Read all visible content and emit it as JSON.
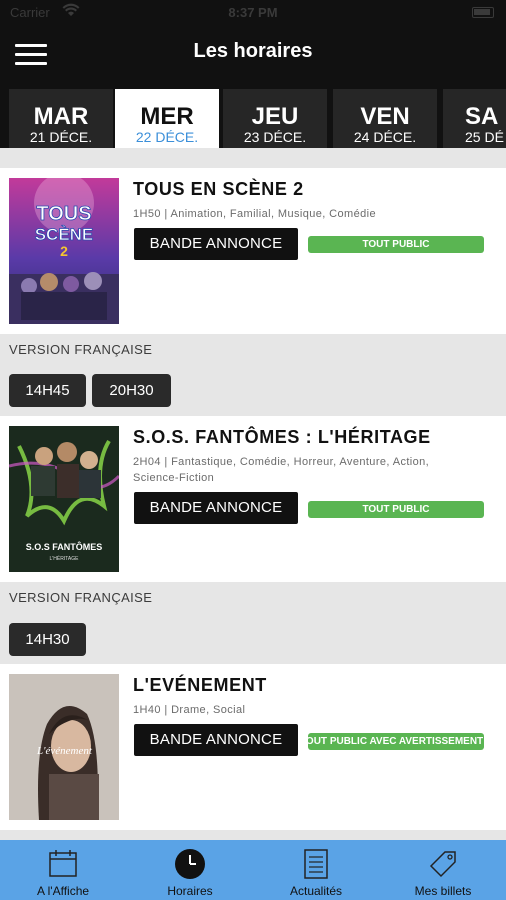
{
  "status": {
    "carrier": "Carrier",
    "time": "8:37 PM"
  },
  "header": {
    "title": "Les horaires"
  },
  "days": [
    {
      "day": "MAR",
      "date": "21 DÉCE."
    },
    {
      "day": "MER",
      "date": "22 DÉCE."
    },
    {
      "day": "JEU",
      "date": "23 DÉCE."
    },
    {
      "day": "VEN",
      "date": "24 DÉCE."
    },
    {
      "day": "SA",
      "date": "25 DÉ"
    }
  ],
  "movies": [
    {
      "title": "TOUS EN SCÈNE 2",
      "meta": "1H50 | Animation, Familial, Musique, Comédie",
      "trailer": "BANDE ANNONCE",
      "rating": "TOUT PUBLIC",
      "poster_text_1": "TOUS",
      "poster_text_2": "SCÈNE",
      "poster_text_3": "2",
      "version": "VERSION FRANÇAISE",
      "showtimes": [
        "14H45",
        "20H30"
      ]
    },
    {
      "title": "S.O.S. FANTÔMES : L'HÉRITAGE",
      "meta_1": "2H04 | Fantastique, Comédie, Horreur, Aventure, Action,",
      "meta_2": "Science-Fiction",
      "trailer": "BANDE ANNONCE",
      "rating": "TOUT PUBLIC",
      "poster_text_1": "S.O.S FANTÔMES",
      "poster_text_2": "L'HÉRITAGE",
      "version": "VERSION FRANÇAISE",
      "showtimes": [
        "14H30"
      ]
    },
    {
      "title": "L'EVÉNEMENT",
      "meta": "1H40 | Drame, Social",
      "trailer": "BANDE ANNONCE",
      "rating": "TOUT PUBLIC AVEC AVERTISSEMENT",
      "poster_text_1": "L'événement"
    }
  ],
  "tabs": [
    {
      "label": "A l'Affiche",
      "icon": "calendar-icon"
    },
    {
      "label": "Horaires",
      "icon": "clock-icon"
    },
    {
      "label": "Actualités",
      "icon": "news-icon"
    },
    {
      "label": "Mes billets",
      "icon": "ticket-icon"
    }
  ],
  "colors": {
    "bar": "#111111",
    "active_date": "#3b8fd9",
    "rating": "#5ab552",
    "tabbar": "#5aa3e6"
  }
}
